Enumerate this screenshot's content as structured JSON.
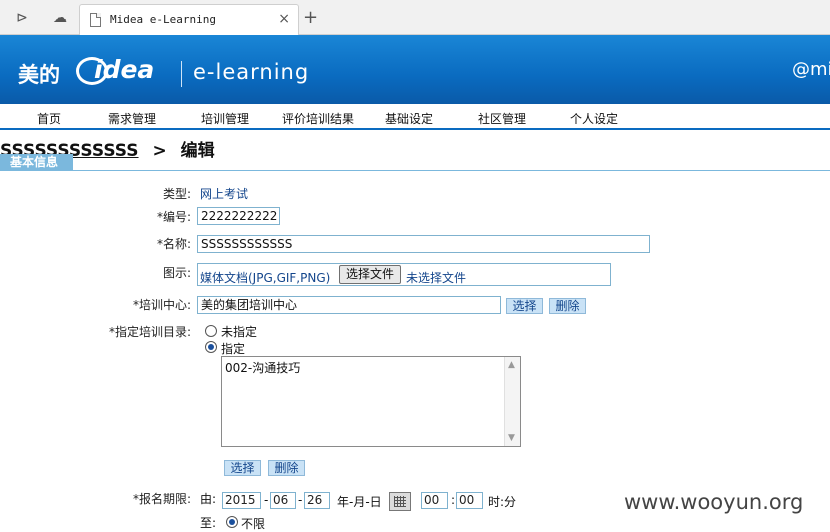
{
  "browser": {
    "tab_title": "Midea e-Learning",
    "close": "×",
    "new_tab": "+"
  },
  "banner": {
    "cn_name": "美的",
    "brand": "idea",
    "product": "e-learning",
    "user": "@mi"
  },
  "nav": [
    "首页",
    "需求管理",
    "培训管理",
    "评价培训结果",
    "基础设定",
    "社区管理",
    "个人设定"
  ],
  "page": {
    "title": "SSSSSSSSSSSS",
    "sep": ">",
    "mode": "编辑",
    "section": "基本信息"
  },
  "form": {
    "type_label": "类型:",
    "type_value": "网上考试",
    "code_label": "*编号:",
    "code_value": "2222222222",
    "name_label": "*名称:",
    "name_value": "SSSSSSSSSSSS",
    "icon_label": "图示:",
    "icon_hint": "媒体文档(JPG,GIF,PNG)",
    "file_button": "选择文件",
    "file_status": "未选择文件",
    "center_label": "*培训中心:",
    "center_value": "美的集团培训中心",
    "select": "选择",
    "delete": "删除",
    "catalog_label": "*指定培训目录:",
    "opt_unassigned": "未指定",
    "opt_assigned": "指定",
    "catalog_items": [
      "002-沟通技巧"
    ],
    "deadline_label": "*报名期限:",
    "from": "由:",
    "to": "至:",
    "year": "2015",
    "month": "06",
    "day": "26",
    "dash": "-",
    "date_fmt": "年-月-日",
    "hour": "00",
    "minute": "00",
    "colon": ":",
    "time_fmt": "时:分",
    "unlimited": "不限"
  },
  "watermark": "www.wooyun.org"
}
